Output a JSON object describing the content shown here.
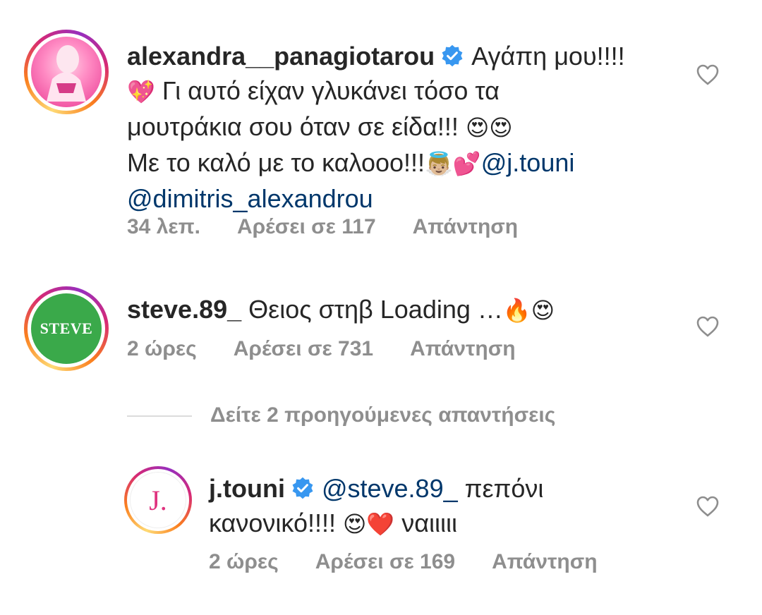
{
  "comments": [
    {
      "username": "alexandra__panagiotarou",
      "verified": true,
      "text_start": "Αγάπη μου!!!!",
      "line2_emoji": "💖",
      "line2_text": "Γι αυτό είχαν γλυκάνει τόσο τα",
      "line3_text": "μουτράκια σου όταν σε είδα!!!",
      "line3_emoji": "😍😍",
      "line4_text": "Με το καλό με το καλοοο!!!",
      "line4_emoji": "👼🏼💕",
      "mention1": "@j.touni",
      "mention2": "@dimitris_alexandrou",
      "time": "34 λεπ.",
      "likes": "Αρέσει σε 117",
      "reply": "Απάντηση"
    },
    {
      "username": "steve.89_",
      "avatar_text": "STEVE",
      "text": "Θειος στηβ Loading …",
      "emoji": "🔥😍",
      "time": "2 ώρες",
      "likes": "Αρέσει σε 731",
      "reply": "Απάντηση"
    }
  ],
  "view_replies": "Δείτε 2 προηγούμενες απαντήσεις",
  "reply_comment": {
    "username": "j.touni",
    "verified": true,
    "avatar_text": "J.",
    "mention": "@steve.89_",
    "text_a": "πεπόνι",
    "text_b": "κανονικό!!!!",
    "emoji": "😍❤️",
    "text_c": "ναιιιιι",
    "time": "2 ώρες",
    "likes": "Αρέσει σε 169",
    "reply": "Απάντηση"
  },
  "colors": {
    "verified_blue": "#3897f0",
    "steve_avatar_green": "#3aa94a",
    "jtouni_pink": "#e0337f",
    "mention_blue": "#00376b",
    "meta_gray": "#8e8e8e"
  },
  "icons": [
    "heart-outline-icon",
    "verified-badge-icon"
  ]
}
